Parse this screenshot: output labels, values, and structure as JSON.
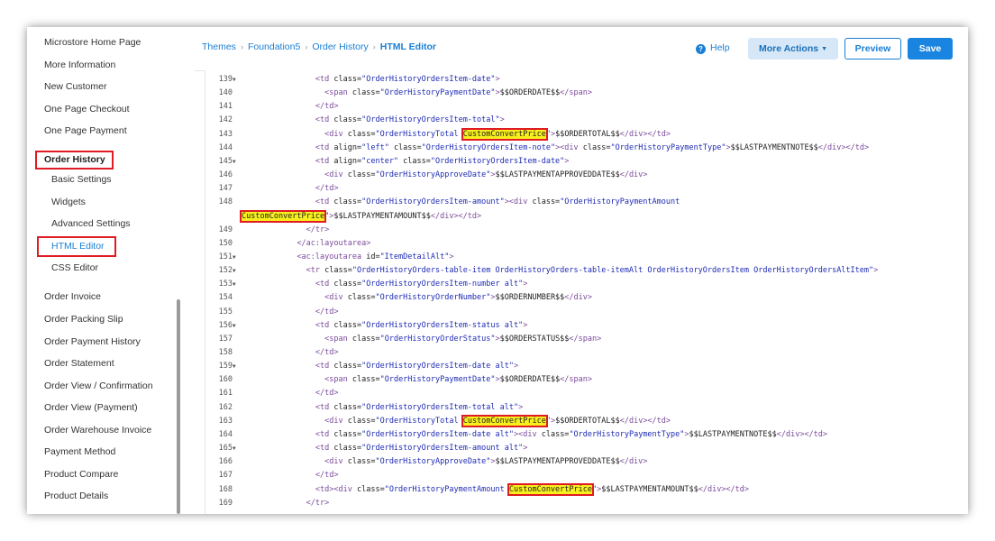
{
  "sidebar": {
    "items": [
      {
        "label": "Microstore Home Page",
        "type": "item"
      },
      {
        "label": "More Information",
        "type": "item"
      },
      {
        "label": "New Customer",
        "type": "item"
      },
      {
        "label": "One Page Checkout",
        "type": "item"
      },
      {
        "label": "One Page Payment",
        "type": "item"
      },
      {
        "label": "Order History",
        "type": "parent"
      },
      {
        "label": "Basic Settings",
        "type": "sub"
      },
      {
        "label": "Widgets",
        "type": "sub"
      },
      {
        "label": "Advanced Settings",
        "type": "sub"
      },
      {
        "label": "HTML Editor",
        "type": "sub-active"
      },
      {
        "label": "CSS Editor",
        "type": "sub"
      },
      {
        "label": "Order Invoice",
        "type": "item"
      },
      {
        "label": "Order Packing Slip",
        "type": "item"
      },
      {
        "label": "Order Payment History",
        "type": "item"
      },
      {
        "label": "Order Statement",
        "type": "item"
      },
      {
        "label": "Order View / Confirmation",
        "type": "item"
      },
      {
        "label": "Order View (Payment)",
        "type": "item"
      },
      {
        "label": "Order Warehouse Invoice",
        "type": "item"
      },
      {
        "label": "Payment Method",
        "type": "item"
      },
      {
        "label": "Product Compare",
        "type": "item"
      },
      {
        "label": "Product Details",
        "type": "item"
      }
    ]
  },
  "breadcrumb": {
    "items": [
      "Themes",
      "Foundation5",
      "Order History"
    ],
    "current": "HTML Editor"
  },
  "header": {
    "help_label": "Help",
    "help_icon": "?",
    "more_actions_label": "More Actions",
    "preview_label": "Preview",
    "save_label": "Save"
  },
  "colors": {
    "accent": "#1a7fd4",
    "highlight": "#f7f01c",
    "annotation_red": "#e01b24"
  },
  "code_lines": [
    {
      "n": "139",
      "fold": true,
      "indent": 16,
      "parts": [
        [
          "t",
          "<td "
        ],
        [
          "a",
          "class="
        ],
        [
          "s",
          "\"OrderHistoryOrdersItem-date\""
        ],
        [
          "t",
          ">"
        ]
      ]
    },
    {
      "n": "140",
      "fold": false,
      "indent": 18,
      "parts": [
        [
          "t",
          "<span "
        ],
        [
          "a",
          "class="
        ],
        [
          "s",
          "\"OrderHistoryPaymentDate\""
        ],
        [
          "t",
          ">"
        ],
        [
          "x",
          "$$ORDERDATE$$"
        ],
        [
          "t",
          "</span>"
        ]
      ]
    },
    {
      "n": "141",
      "fold": false,
      "indent": 16,
      "parts": [
        [
          "t",
          "</td>"
        ]
      ]
    },
    {
      "n": "142",
      "fold": false,
      "indent": 16,
      "parts": [
        [
          "t",
          "<td "
        ],
        [
          "a",
          "class="
        ],
        [
          "s",
          "\"OrderHistoryOrdersItem-total\""
        ],
        [
          "t",
          ">"
        ]
      ]
    },
    {
      "n": "143",
      "fold": false,
      "indent": 18,
      "parts": [
        [
          "t",
          "<div "
        ],
        [
          "a",
          "class="
        ],
        [
          "s",
          "\"OrderHistoryTotal "
        ],
        [
          "m",
          "CustomConvertPrice"
        ],
        [
          "s",
          "\""
        ],
        [
          "t",
          ">"
        ],
        [
          "x",
          "$$ORDERTOTAL$$"
        ],
        [
          "t",
          "</div></td>"
        ]
      ]
    },
    {
      "n": "144",
      "fold": false,
      "indent": 16,
      "parts": [
        [
          "t",
          "<td "
        ],
        [
          "a",
          "align="
        ],
        [
          "s",
          "\"left\" "
        ],
        [
          "a",
          "class="
        ],
        [
          "s",
          "\"OrderHistoryOrdersItem-note\""
        ],
        [
          "t",
          ">"
        ],
        [
          "t",
          "<div "
        ],
        [
          "a",
          "class="
        ],
        [
          "s",
          "\"OrderHistoryPaymentType\""
        ],
        [
          "t",
          ">"
        ],
        [
          "x",
          "$$LASTPAYMENTNOTE$$"
        ],
        [
          "t",
          "</div></td>"
        ]
      ]
    },
    {
      "n": "145",
      "fold": true,
      "indent": 16,
      "parts": [
        [
          "t",
          "<td "
        ],
        [
          "a",
          "align="
        ],
        [
          "s",
          "\"center\" "
        ],
        [
          "a",
          "class="
        ],
        [
          "s",
          "\"OrderHistoryOrdersItem-date\""
        ],
        [
          "t",
          ">"
        ]
      ]
    },
    {
      "n": "146",
      "fold": false,
      "indent": 18,
      "parts": [
        [
          "t",
          "<div "
        ],
        [
          "a",
          "class="
        ],
        [
          "s",
          "\"OrderHistoryApproveDate\""
        ],
        [
          "t",
          ">"
        ],
        [
          "x",
          "$$LASTPAYMENTAPPROVEDDATE$$"
        ],
        [
          "t",
          "</div>"
        ]
      ]
    },
    {
      "n": "147",
      "fold": false,
      "indent": 16,
      "parts": [
        [
          "t",
          "</td>"
        ]
      ]
    },
    {
      "n": "148",
      "fold": false,
      "indent": 16,
      "parts": [
        [
          "t",
          "<td "
        ],
        [
          "a",
          "class="
        ],
        [
          "s",
          "\"OrderHistoryOrdersItem-amount\""
        ],
        [
          "t",
          ">"
        ],
        [
          "t",
          "<div "
        ],
        [
          "a",
          "class="
        ],
        [
          "s",
          "\"OrderHistoryPaymentAmount"
        ]
      ]
    },
    {
      "n": "",
      "fold": false,
      "indent": 0,
      "parts": [
        [
          "m",
          "CustomConvertPrice"
        ],
        [
          "s",
          "\""
        ],
        [
          "t",
          ">"
        ],
        [
          "x",
          "$$LASTPAYMENTAMOUNT$$"
        ],
        [
          "t",
          "</div></td>"
        ]
      ]
    },
    {
      "n": "149",
      "fold": false,
      "indent": 14,
      "parts": [
        [
          "t",
          "</tr>"
        ]
      ]
    },
    {
      "n": "150",
      "fold": false,
      "indent": 12,
      "parts": [
        [
          "t",
          "</ac:layoutarea>"
        ]
      ]
    },
    {
      "n": "151",
      "fold": true,
      "indent": 12,
      "parts": [
        [
          "t",
          "<ac:layoutarea "
        ],
        [
          "a",
          "id="
        ],
        [
          "s",
          "\"ItemDetailAlt\""
        ],
        [
          "t",
          ">"
        ]
      ]
    },
    {
      "n": "152",
      "fold": true,
      "indent": 14,
      "parts": [
        [
          "t",
          "<tr "
        ],
        [
          "a",
          "class="
        ],
        [
          "s",
          "\"OrderHistoryOrders-table-item OrderHistoryOrders-table-itemAlt OrderHistoryOrdersItem OrderHistoryOrdersAltItem\""
        ],
        [
          "t",
          ">"
        ]
      ]
    },
    {
      "n": "153",
      "fold": true,
      "indent": 16,
      "parts": [
        [
          "t",
          "<td "
        ],
        [
          "a",
          "class="
        ],
        [
          "s",
          "\"OrderHistoryOrdersItem-number alt\""
        ],
        [
          "t",
          ">"
        ]
      ]
    },
    {
      "n": "154",
      "fold": false,
      "indent": 18,
      "parts": [
        [
          "t",
          "<div "
        ],
        [
          "a",
          "class="
        ],
        [
          "s",
          "\"OrderHistoryOrderNumber\""
        ],
        [
          "t",
          ">"
        ],
        [
          "x",
          "$$ORDERNUMBER$$"
        ],
        [
          "t",
          "</div>"
        ]
      ]
    },
    {
      "n": "155",
      "fold": false,
      "indent": 16,
      "parts": [
        [
          "t",
          "</td>"
        ]
      ]
    },
    {
      "n": "156",
      "fold": true,
      "indent": 16,
      "parts": [
        [
          "t",
          "<td "
        ],
        [
          "a",
          "class="
        ],
        [
          "s",
          "\"OrderHistoryOrdersItem-status alt\""
        ],
        [
          "t",
          ">"
        ]
      ]
    },
    {
      "n": "157",
      "fold": false,
      "indent": 18,
      "parts": [
        [
          "t",
          "<span "
        ],
        [
          "a",
          "class="
        ],
        [
          "s",
          "\"OrderHistoryOrderStatus\""
        ],
        [
          "t",
          ">"
        ],
        [
          "x",
          "$$ORDERSTATUS$$"
        ],
        [
          "t",
          "</span>"
        ]
      ]
    },
    {
      "n": "158",
      "fold": false,
      "indent": 16,
      "parts": [
        [
          "t",
          "</td>"
        ]
      ]
    },
    {
      "n": "159",
      "fold": true,
      "indent": 16,
      "parts": [
        [
          "t",
          "<td "
        ],
        [
          "a",
          "class="
        ],
        [
          "s",
          "\"OrderHistoryOrdersItem-date alt\""
        ],
        [
          "t",
          ">"
        ]
      ]
    },
    {
      "n": "160",
      "fold": false,
      "indent": 18,
      "parts": [
        [
          "t",
          "<span "
        ],
        [
          "a",
          "class="
        ],
        [
          "s",
          "\"OrderHistoryPaymentDate\""
        ],
        [
          "t",
          ">"
        ],
        [
          "x",
          "$$ORDERDATE$$"
        ],
        [
          "t",
          "</span>"
        ]
      ]
    },
    {
      "n": "161",
      "fold": false,
      "indent": 16,
      "parts": [
        [
          "t",
          "</td>"
        ]
      ]
    },
    {
      "n": "162",
      "fold": false,
      "indent": 16,
      "parts": [
        [
          "t",
          "<td "
        ],
        [
          "a",
          "class="
        ],
        [
          "s",
          "\"OrderHistoryOrdersItem-total alt\""
        ],
        [
          "t",
          ">"
        ]
      ]
    },
    {
      "n": "163",
      "fold": false,
      "indent": 18,
      "parts": [
        [
          "t",
          "<div "
        ],
        [
          "a",
          "class="
        ],
        [
          "s",
          "\"OrderHistoryTotal "
        ],
        [
          "m",
          "CustomConvertPrice"
        ],
        [
          "s",
          "\""
        ],
        [
          "t",
          ">"
        ],
        [
          "x",
          "$$ORDERTOTAL$$"
        ],
        [
          "t",
          "</div></td>"
        ]
      ]
    },
    {
      "n": "164",
      "fold": false,
      "indent": 16,
      "parts": [
        [
          "t",
          "<td "
        ],
        [
          "a",
          "class="
        ],
        [
          "s",
          "\"OrderHistoryOrdersItem-date alt\""
        ],
        [
          "t",
          ">"
        ],
        [
          "t",
          "<div "
        ],
        [
          "a",
          "class="
        ],
        [
          "s",
          "\"OrderHistoryPaymentType\""
        ],
        [
          "t",
          ">"
        ],
        [
          "x",
          "$$LASTPAYMENTNOTE$$"
        ],
        [
          "t",
          "</div></td>"
        ]
      ]
    },
    {
      "n": "165",
      "fold": true,
      "indent": 16,
      "parts": [
        [
          "t",
          "<td "
        ],
        [
          "a",
          "class="
        ],
        [
          "s",
          "\"OrderHistoryOrdersItem-amount alt\""
        ],
        [
          "t",
          ">"
        ]
      ]
    },
    {
      "n": "166",
      "fold": false,
      "indent": 18,
      "parts": [
        [
          "t",
          "<div "
        ],
        [
          "a",
          "class="
        ],
        [
          "s",
          "\"OrderHistoryApproveDate\""
        ],
        [
          "t",
          ">"
        ],
        [
          "x",
          "$$LASTPAYMENTAPPROVEDDATE$$"
        ],
        [
          "t",
          "</div>"
        ]
      ]
    },
    {
      "n": "167",
      "fold": false,
      "indent": 16,
      "parts": [
        [
          "t",
          "</td>"
        ]
      ]
    },
    {
      "n": "168",
      "fold": false,
      "indent": 16,
      "parts": [
        [
          "t",
          "<td>"
        ],
        [
          "t",
          "<div "
        ],
        [
          "a",
          "class="
        ],
        [
          "s",
          "\"OrderHistoryPaymentAmount "
        ],
        [
          "m",
          "CustomConvertPrice"
        ],
        [
          "s",
          "\""
        ],
        [
          "t",
          ">"
        ],
        [
          "x",
          "$$LASTPAYMENTAMOUNT$$"
        ],
        [
          "t",
          "</div></td>"
        ]
      ]
    },
    {
      "n": "169",
      "fold": false,
      "indent": 14,
      "parts": [
        [
          "t",
          "</tr>"
        ]
      ]
    }
  ]
}
